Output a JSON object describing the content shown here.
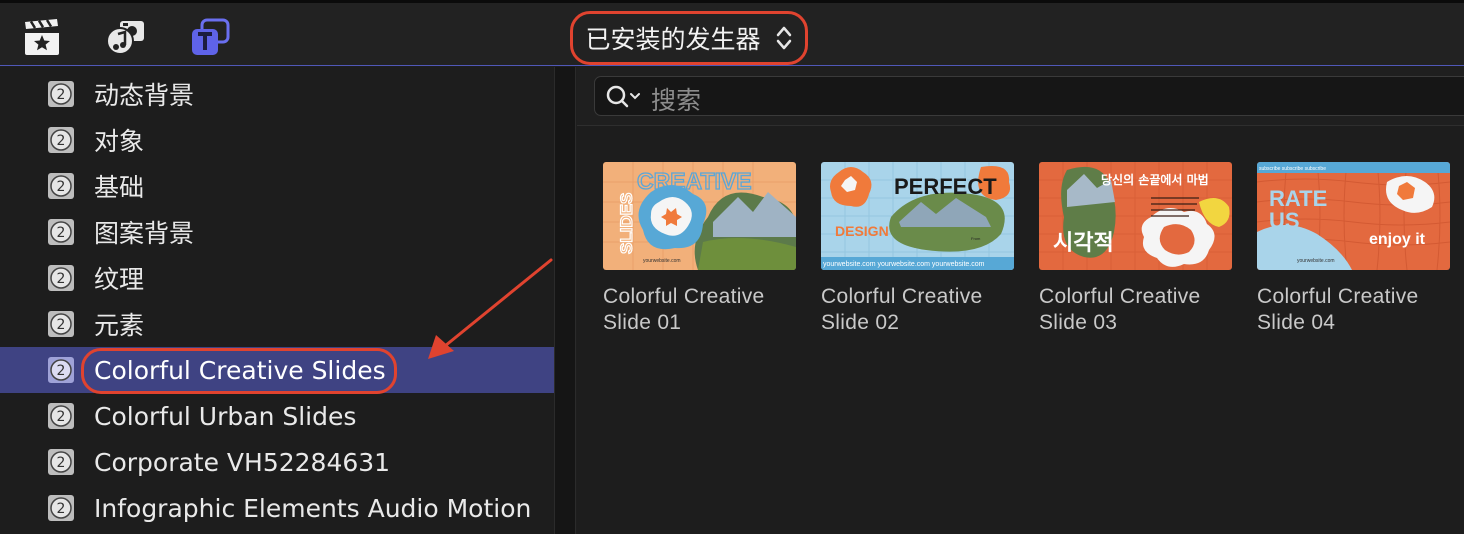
{
  "toolbar": {
    "icons": [
      "clapper-star-icon",
      "photos-music-icon",
      "titles-generators-icon"
    ],
    "popup_label": "已安装的发生器"
  },
  "sidebar": {
    "items": [
      {
        "label": "动态背景",
        "selected": false
      },
      {
        "label": "对象",
        "selected": false
      },
      {
        "label": "基础",
        "selected": false
      },
      {
        "label": "图案背景",
        "selected": false
      },
      {
        "label": "纹理",
        "selected": false
      },
      {
        "label": "元素",
        "selected": false
      },
      {
        "label": "Colorful Creative Slides",
        "selected": true
      },
      {
        "label": "Colorful Urban Slides",
        "selected": false
      },
      {
        "label": "Corporate VH52284631",
        "selected": false
      },
      {
        "label": "Infographic Elements Audio Motion",
        "selected": false
      }
    ]
  },
  "search": {
    "placeholder": "搜索"
  },
  "browser": {
    "items": [
      {
        "name": "Colorful Creative Slide 01",
        "thumb_text": [
          "CREATIVE",
          "SLIDES",
          "yourwebsite.com"
        ]
      },
      {
        "name": "Colorful Creative Slide 02",
        "thumb_text": [
          "PERFECT",
          "DESIGN",
          "yourwebsite.com"
        ]
      },
      {
        "name": "Colorful Creative Slide 03",
        "thumb_text": [
          "당신의 손끝에서 마법",
          "시각적"
        ]
      },
      {
        "name": "Colorful Creative Slide 04",
        "thumb_text": [
          "RATE US",
          "enjoy it",
          "subscribe"
        ]
      }
    ]
  },
  "colors": {
    "accent_red": "#e0432f",
    "selection": "#3f4383",
    "background": "#1e1e1e"
  }
}
